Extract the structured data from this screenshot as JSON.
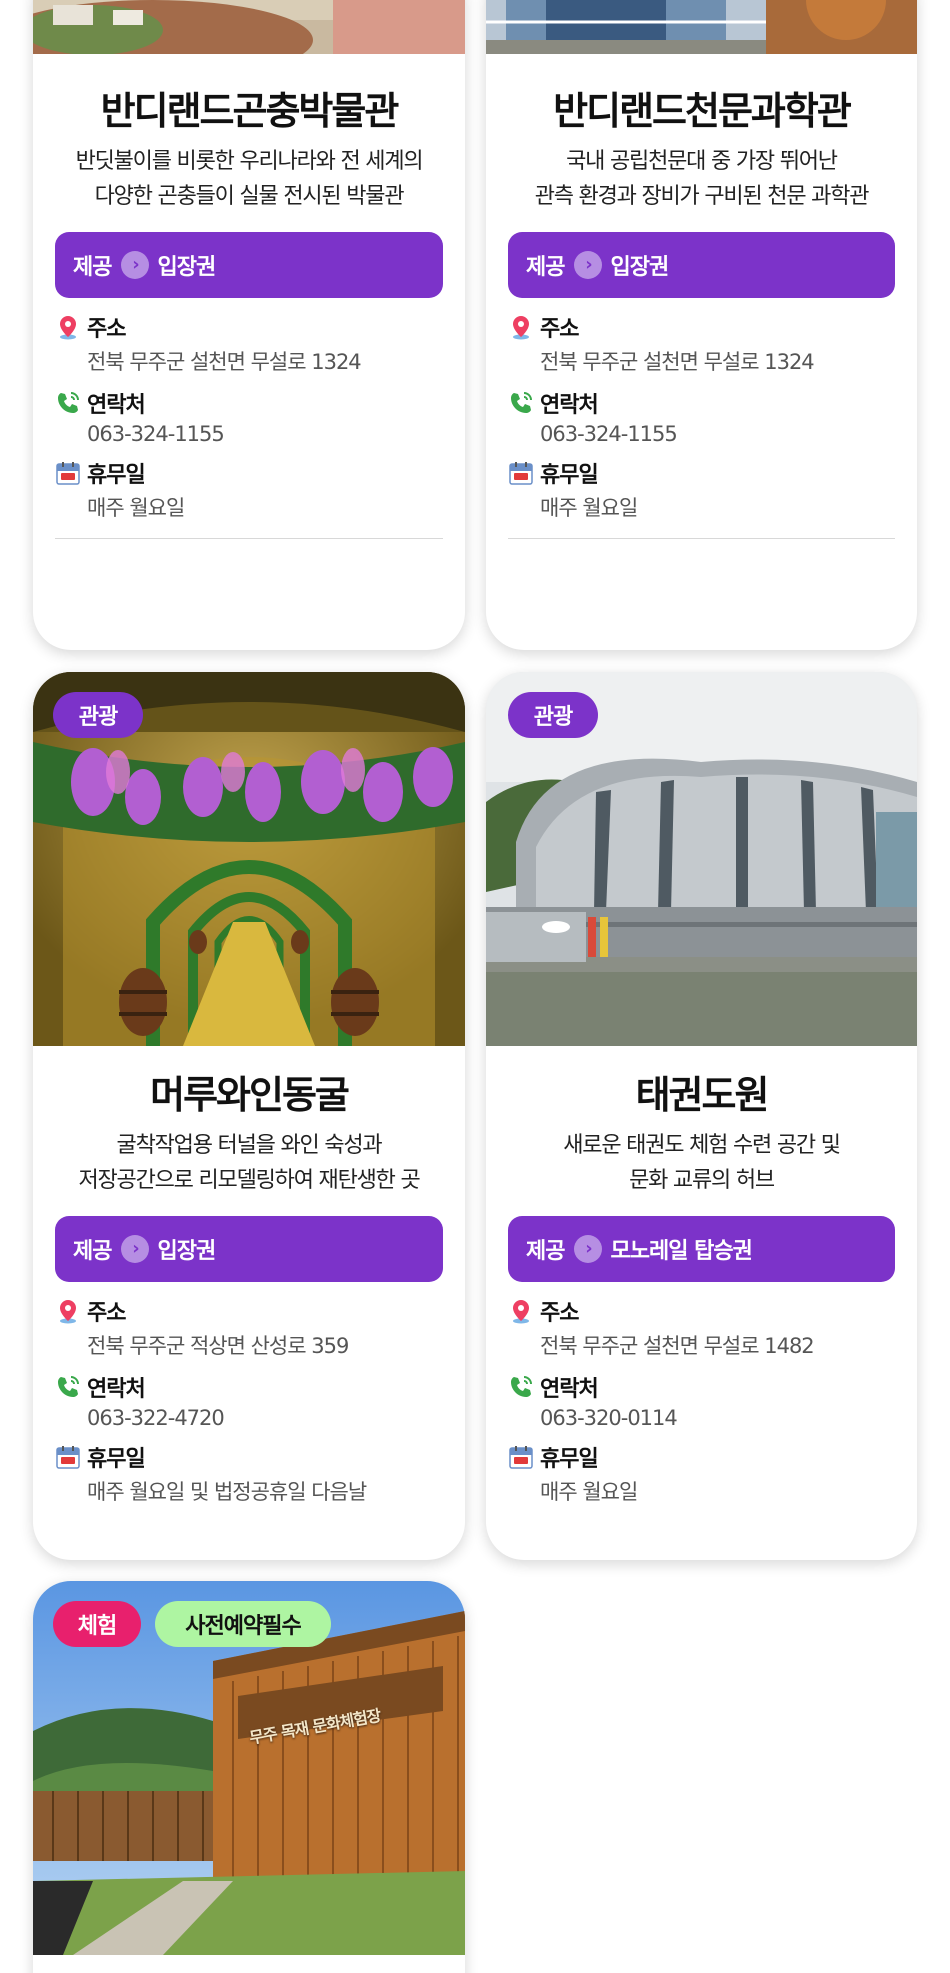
{
  "cards": [
    {
      "title": "반디랜드곤충박물관",
      "desc1": "반딧불이를 비롯한 우리나라와 전 세계의",
      "desc2": "다양한 곤충들이 실물 전시된 박물관",
      "offer_label": "제공",
      "offer_value": "입장권",
      "address_label": "주소",
      "address": "전북 무주군 설천면 무설로 1324",
      "phone_label": "연락처",
      "phone": "063-324-1155",
      "closed_label": "휴무일",
      "closed": "매주 월요일"
    },
    {
      "title": "반디랜드천문과학관",
      "desc1": "국내 공립천문대 중 가장 뛰어난",
      "desc2": "관측 환경과 장비가 구비된 천문 과학관",
      "offer_label": "제공",
      "offer_value": "입장권",
      "address_label": "주소",
      "address": "전북 무주군 설천면 무설로 1324",
      "phone_label": "연락처",
      "phone": "063-324-1155",
      "closed_label": "휴무일",
      "closed": "매주 월요일"
    },
    {
      "tag": "관광",
      "title": "머루와인동굴",
      "desc1": "굴착작업용 터널을 와인 숙성과",
      "desc2": "저장공간으로 리모델링하여 재탄생한 곳",
      "offer_label": "제공",
      "offer_value": "입장권",
      "address_label": "주소",
      "address": "전북 무주군 적상면 산성로 359",
      "phone_label": "연락처",
      "phone": "063-322-4720",
      "closed_label": "휴무일",
      "closed": "매주 월요일 및 법정공휴일 다음날"
    },
    {
      "tag": "관광",
      "title": "태권도원",
      "desc1": "새로운 태권도 체험 수련 공간 및",
      "desc2": "문화 교류의 허브",
      "offer_label": "제공",
      "offer_value": "모노레일 탑승권",
      "address_label": "주소",
      "address": "전북 무주군 설천면 무설로 1482",
      "phone_label": "연락처",
      "phone": "063-320-0114",
      "closed_label": "휴무일",
      "closed": "매주 월요일"
    },
    {
      "tag1": "체험",
      "tag2": "사전예약필수",
      "sign_text": "무주 목재 문화체험장"
    }
  ],
  "icons": {
    "address": "location-pin-icon",
    "phone": "phone-icon",
    "closed": "calendar-day-icon",
    "offer": "chevron-right-icon"
  },
  "colors": {
    "offer_bg": "#7c33c9",
    "tag_purple": "#7c33c9",
    "tag_pink": "#e8206d",
    "tag_green": "#aef5a2"
  }
}
